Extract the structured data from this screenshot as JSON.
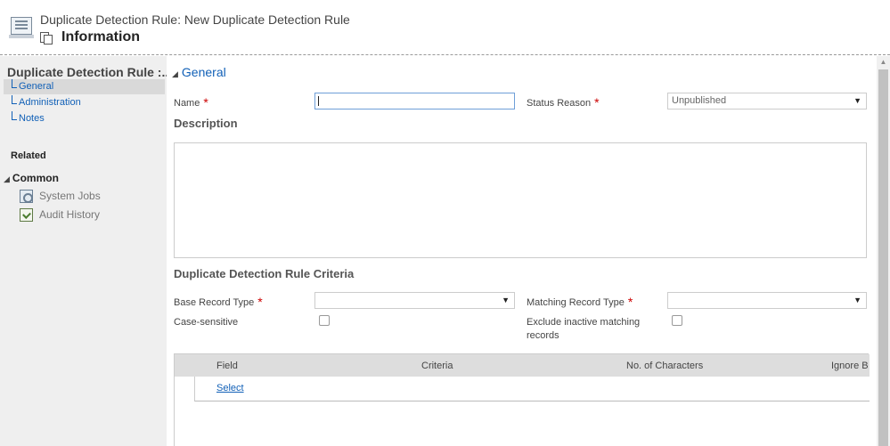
{
  "header": {
    "title": "Duplicate Detection Rule: New Duplicate Detection Rule",
    "form_name": "Information"
  },
  "sidebar": {
    "entity_name": "Duplicate Detection Rule :...",
    "nav": [
      {
        "label": "General",
        "selected": true
      },
      {
        "label": "Administration",
        "selected": false
      },
      {
        "label": "Notes",
        "selected": false
      }
    ],
    "related_label": "Related",
    "common_label": "Common",
    "related_items": [
      {
        "label": "System Jobs",
        "icon": "system-jobs-icon"
      },
      {
        "label": "Audit History",
        "icon": "audit-history-icon"
      }
    ]
  },
  "form": {
    "section_title": "General",
    "name_label": "Name",
    "name_value": "",
    "status_reason_label": "Status Reason",
    "status_reason_value": "Unpublished",
    "description_label": "Description",
    "description_value": "",
    "criteria_title": "Duplicate Detection Rule Criteria",
    "base_record_type_label": "Base Record Type",
    "base_record_type_value": "",
    "matching_record_type_label": "Matching Record Type",
    "matching_record_type_value": "",
    "case_sensitive_label": "Case-sensitive",
    "case_sensitive_checked": false,
    "exclude_inactive_label_1": "Exclude inactive matching",
    "exclude_inactive_label_2": "records",
    "exclude_inactive_checked": false,
    "required_marker": "*"
  },
  "grid": {
    "columns": [
      "Field",
      "Criteria",
      "No. of Characters",
      "Ignore B"
    ],
    "select_link": "Select"
  },
  "colors": {
    "accent": "#1160b7",
    "required": "#cc0000",
    "sidebar_bg": "#efefef"
  }
}
